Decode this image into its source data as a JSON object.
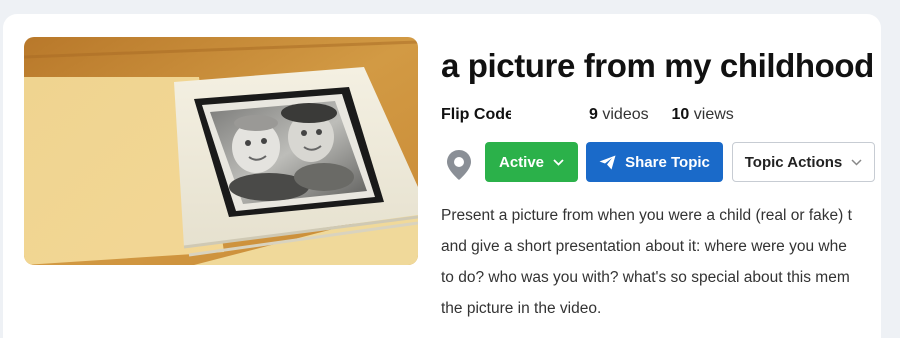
{
  "topic": {
    "title": "a picture from my childhood",
    "owner": "Flip Code",
    "video_count": "9",
    "videos_label": "videos",
    "view_count": "10",
    "views_label": "views"
  },
  "actions": {
    "status_label": "Active",
    "share_label": "Share Topic",
    "topic_actions_label": "Topic Actions"
  },
  "description": {
    "lines": [
      "Present a picture from when you were a child (real or fake) t",
      "and give a short presentation about it: where were you whe",
      "to do? who was you with? what's so special about this mem",
      "the picture in the video."
    ]
  },
  "colors": {
    "active_green": "#2bb14a",
    "share_blue": "#1a6ac9",
    "pin_gray": "#8a8f96"
  },
  "icons": {
    "location": "map-pin-icon",
    "active_chevron": "chevron-down-icon",
    "share": "paper-plane-icon",
    "topic_chevron": "chevron-down-icon"
  }
}
